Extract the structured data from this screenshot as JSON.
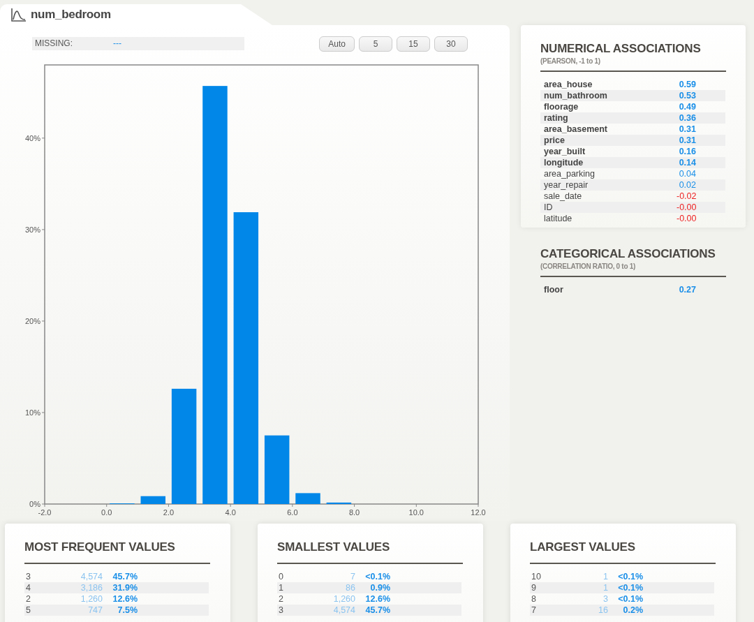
{
  "variable": {
    "name": "num_bedroom",
    "missing_label": "MISSING:",
    "missing_value": "---"
  },
  "bin_buttons": [
    "Auto",
    "5",
    "15",
    "30"
  ],
  "histogram": {
    "chart_data": {
      "type": "bar",
      "x": [
        0.5,
        1.5,
        2.5,
        3.5,
        4.5,
        5.5,
        6.5,
        7.5
      ],
      "series": [
        {
          "color": "#0087e8",
          "values": [
            0.07,
            0.86,
            12.6,
            45.7,
            31.9,
            7.5,
            1.19,
            0.16
          ]
        }
      ],
      "xlim": [
        -2,
        12
      ],
      "ylim": [
        0,
        48
      ],
      "xticks": [
        {
          "value": -2,
          "label": "-2.0"
        },
        {
          "value": 0,
          "label": "0.0"
        },
        {
          "value": 2,
          "label": "2.0"
        },
        {
          "value": 4,
          "label": "4.0"
        },
        {
          "value": 6,
          "label": "6.0"
        },
        {
          "value": 8,
          "label": "8.0"
        },
        {
          "value": 10,
          "label": "10.0"
        },
        {
          "value": 12,
          "label": "12.0"
        }
      ],
      "yticks": [
        {
          "value": 0,
          "label": "0%"
        },
        {
          "value": 10,
          "label": "10%"
        },
        {
          "value": 20,
          "label": "20%"
        },
        {
          "value": 30,
          "label": "30%"
        },
        {
          "value": 40,
          "label": "40%"
        }
      ]
    }
  },
  "numerical_associations": {
    "title": "NUMERICAL ASSOCIATIONS",
    "subtitle": "(PEARSON, -1 to 1)",
    "rows": [
      {
        "name": "area_house",
        "value": "0.59",
        "bold": true,
        "color": "#1a8fe8"
      },
      {
        "name": "num_bathroom",
        "value": "0.53",
        "bold": true,
        "color": "#1a8fe8"
      },
      {
        "name": "floorage",
        "value": "0.49",
        "bold": true,
        "color": "#1a8fe8"
      },
      {
        "name": "rating",
        "value": "0.36",
        "bold": true,
        "color": "#1a8fe8"
      },
      {
        "name": "area_basement",
        "value": "0.31",
        "bold": true,
        "color": "#1a8fe8"
      },
      {
        "name": "price",
        "value": "0.31",
        "bold": true,
        "color": "#1a8fe8"
      },
      {
        "name": "year_built",
        "value": "0.16",
        "bold": true,
        "color": "#1a8fe8"
      },
      {
        "name": "longitude",
        "value": "0.14",
        "bold": true,
        "color": "#1a8fe8"
      },
      {
        "name": "area_parking",
        "value": "0.04",
        "bold": false,
        "color": "#1a8fe8"
      },
      {
        "name": "year_repair",
        "value": "0.02",
        "bold": false,
        "color": "#1a8fe8"
      },
      {
        "name": "sale_date",
        "value": "-0.02",
        "bold": false,
        "color": "#ee2222"
      },
      {
        "name": "ID",
        "value": "-0.00",
        "bold": false,
        "color": "#ee2222"
      },
      {
        "name": "latitude",
        "value": "-0.00",
        "bold": false,
        "color": "#ee2222"
      }
    ]
  },
  "categorical_associations": {
    "title": "CATEGORICAL ASSOCIATIONS",
    "subtitle": "(CORRELATION RATIO, 0 to 1)",
    "rows": [
      {
        "name": "floor",
        "value": "0.27",
        "bold": true,
        "color": "#1a8fe8"
      }
    ]
  },
  "value_tables": [
    {
      "title": "MOST FREQUENT VALUES",
      "rows": [
        {
          "value": "3",
          "count": "4,574",
          "percent": "45.7%"
        },
        {
          "value": "4",
          "count": "3,186",
          "percent": "31.9%"
        },
        {
          "value": "2",
          "count": "1,260",
          "percent": "12.6%"
        },
        {
          "value": "5",
          "count": "747",
          "percent": "7.5%"
        }
      ]
    },
    {
      "title": "SMALLEST VALUES",
      "rows": [
        {
          "value": "0",
          "count": "7",
          "percent": "<0.1%"
        },
        {
          "value": "1",
          "count": "86",
          "percent": "0.9%"
        },
        {
          "value": "2",
          "count": "1,260",
          "percent": "12.6%"
        },
        {
          "value": "3",
          "count": "4,574",
          "percent": "45.7%"
        }
      ]
    },
    {
      "title": "LARGEST VALUES",
      "rows": [
        {
          "value": "10",
          "count": "1",
          "percent": "<0.1%"
        },
        {
          "value": "9",
          "count": "1",
          "percent": "<0.1%"
        },
        {
          "value": "8",
          "count": "3",
          "percent": "<0.1%"
        },
        {
          "value": "7",
          "count": "16",
          "percent": "0.2%"
        }
      ]
    }
  ]
}
